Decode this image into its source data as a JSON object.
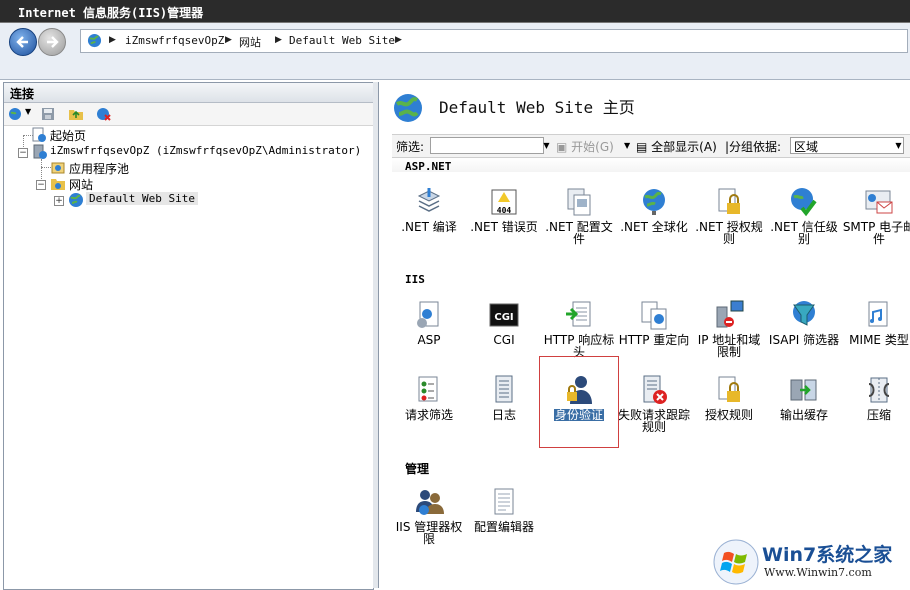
{
  "window": {
    "title": "Internet 信息服务(IIS)管理器"
  },
  "nav": {
    "breadcrumbs": [
      "iZmswfrfqsevOpZ",
      "网站",
      "Default Web Site"
    ]
  },
  "connections": {
    "header": "连接",
    "tree": {
      "start_page": "起始页",
      "server": "iZmswfrfqsevOpZ (iZmswfrfqsevOpZ\\Administrator)",
      "app_pools": "应用程序池",
      "sites": "网站",
      "default_site": "Default Web Site"
    }
  },
  "main": {
    "title": "Default Web Site 主页",
    "filter": {
      "label": "筛选:",
      "start": "开始(G)",
      "show_all": "全部显示(A)",
      "group_by_label": "|分组依据:",
      "group_by_value": "区域"
    },
    "sections": {
      "aspnet": {
        "title": "ASP.NET",
        "items": [
          ".NET 编译",
          ".NET 错误页",
          ".NET 配置文件",
          ".NET 全球化",
          ".NET 授权规则",
          ".NET 信任级别",
          "SMTP 电子邮件"
        ]
      },
      "iis": {
        "title": "IIS",
        "items": [
          "ASP",
          "CGI",
          "HTTP 响应标头",
          "HTTP 重定向",
          "IP 地址和域限制",
          "ISAPI 筛选器",
          "MIME 类型",
          "请求筛选",
          "日志",
          "身份验证",
          "失败请求跟踪规则",
          "授权规则",
          "输出缓存",
          "压缩"
        ]
      },
      "management": {
        "title": "管理",
        "items": [
          "IIS 管理器权限",
          "配置编辑器"
        ]
      }
    },
    "icon_names": {
      "cgi_text": "CGI",
      "error_text": "404"
    }
  },
  "watermark": {
    "brand": "Win7系统之家",
    "url": "Www.Winwin7.com"
  },
  "colors": {
    "titlebar": "#2b2b2b",
    "selection": "#3a6ea5",
    "highlight_border": "#d04040"
  }
}
